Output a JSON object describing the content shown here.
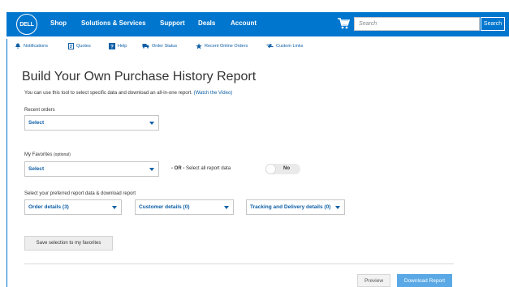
{
  "nav": {
    "logo": "DELL",
    "items": [
      "Shop",
      "Solutions & Services",
      "Support",
      "Deals",
      "Account"
    ],
    "search_placeholder": "Search",
    "search_button": "Search"
  },
  "subnav": {
    "items": [
      "Notifications",
      "Quotes",
      "Help",
      "Order Status",
      "Recent Online Orders",
      "Custom Links"
    ]
  },
  "page": {
    "title": "Build Your Own Purchase History Report",
    "intro": "You can use this tool to select specific data and download an all-in-one report.",
    "intro_link": "(Watch the Video)"
  },
  "recent": {
    "label": "Recent orders",
    "value": "Select"
  },
  "favorites": {
    "label": "My Favorites",
    "label_note": "(optional)",
    "value": "Select",
    "or_text": "- OR -",
    "select_all_text": "Select all report data",
    "toggle_label": "No"
  },
  "report": {
    "label": "Select your preferred report data & download report",
    "dropdowns": [
      "Order details (3)",
      "Customer details (0)",
      "Tracking and Delivery details (0)"
    ]
  },
  "buttons": {
    "save_favorites": "Save selection to my favorites",
    "preview": "Preview",
    "download": "Download Report"
  },
  "colors": {
    "brand": "#0076ce",
    "link": "#0e5fa6"
  }
}
